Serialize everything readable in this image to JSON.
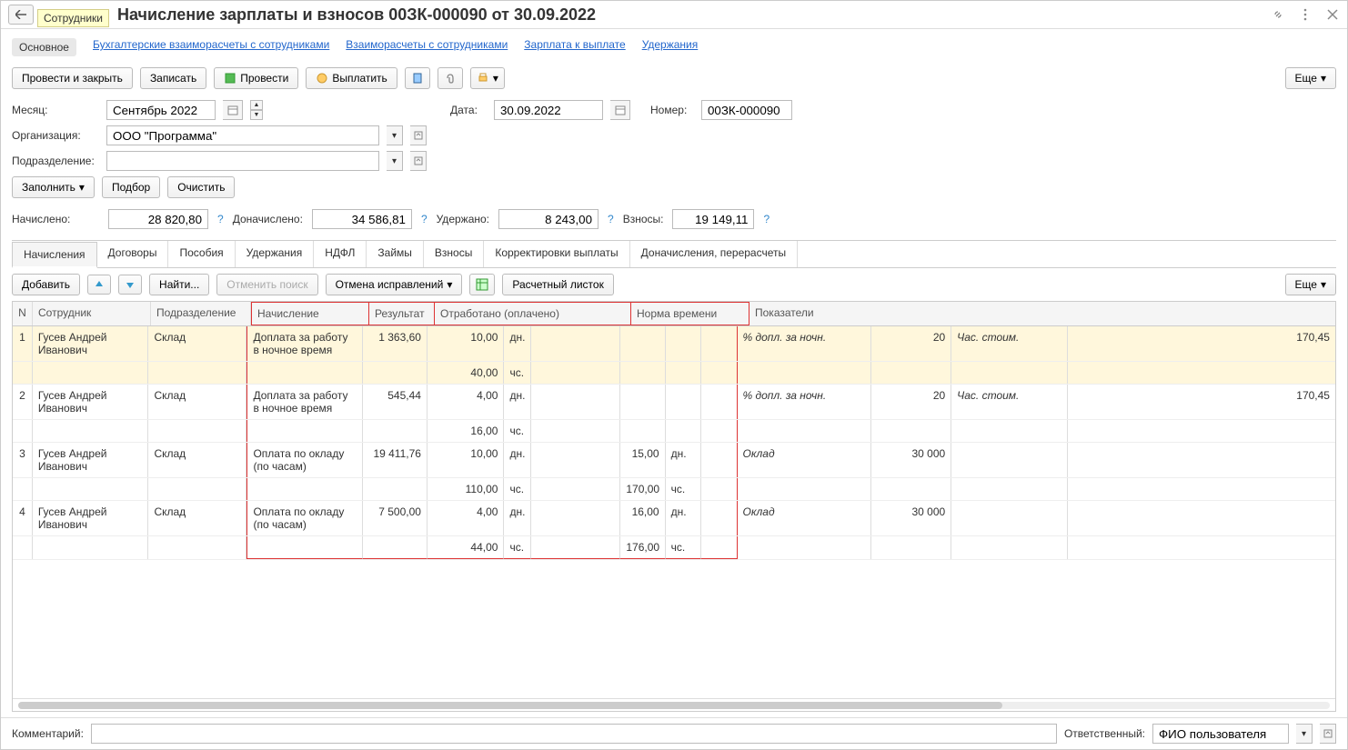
{
  "titlebar": {
    "back_tooltip": "Сотрудники",
    "title": "Начисление зарплаты и взносов 00ЗК-000090 от 30.09.2022"
  },
  "navtabs": {
    "main": "Основное",
    "mutual_emp": "Бухгалтерские взаиморасчеты с сотрудниками",
    "mutual": "Взаиморасчеты с сотрудниками",
    "pay": "Зарплата к выплате",
    "deduct": "Удержания"
  },
  "toolbar": {
    "post_close": "Провести и закрыть",
    "save": "Записать",
    "post": "Провести",
    "pay": "Выплатить",
    "more": "Еще"
  },
  "form": {
    "month_label": "Месяц:",
    "month_value": "Сентябрь 2022",
    "date_label": "Дата:",
    "date_value": "30.09.2022",
    "number_label": "Номер:",
    "number_value": "00ЗК-000090",
    "org_label": "Организация:",
    "org_value": "ООО \"Программа\"",
    "dept_label": "Подразделение:",
    "dept_value": ""
  },
  "fill_bar": {
    "fill": "Заполнить",
    "pick": "Подбор",
    "clear": "Очистить"
  },
  "totals": {
    "accrued_label": "Начислено:",
    "accrued_value": "28 820,80",
    "add_accrued_label": "Доначислено:",
    "add_accrued_value": "34 586,81",
    "withheld_label": "Удержано:",
    "withheld_value": "8 243,00",
    "contrib_label": "Взносы:",
    "contrib_value": "19 149,11"
  },
  "subtabs": {
    "accruals": "Начисления",
    "contracts": "Договоры",
    "benefits": "Пособия",
    "deductions": "Удержания",
    "ndfl": "НДФЛ",
    "loans": "Займы",
    "contribs": "Взносы",
    "corrections": "Корректировки выплаты",
    "add_accruals": "Доначисления, перерасчеты"
  },
  "table_toolbar": {
    "add": "Добавить",
    "find": "Найти...",
    "cancel_find": "Отменить поиск",
    "cancel_fix": "Отмена исправлений",
    "payslip": "Расчетный листок",
    "more": "Еще"
  },
  "columns": {
    "n": "N",
    "emp": "Сотрудник",
    "dep": "Подразделение",
    "accr": "Начисление",
    "res": "Результат",
    "work": "Отработано (оплачено)",
    "norm": "Норма времени",
    "ind": "Показатели"
  },
  "rows": [
    {
      "n": "1",
      "emp": "Гусев Андрей Иванович",
      "dep": "Склад",
      "accr": "Доплата за работу в ночное время",
      "res": "1 363,60",
      "work": "10,00",
      "work_u": "дн.",
      "work2": "40,00",
      "work2_u": "чс.",
      "norm": "",
      "norm_u": "",
      "norm2": "",
      "norm2_u": "",
      "ind": "% допл. за ночн.",
      "ind_v": "20",
      "ind2": "Час. стоим.",
      "ind2_v": "170,45"
    },
    {
      "n": "2",
      "emp": "Гусев Андрей Иванович",
      "dep": "Склад",
      "accr": "Доплата за работу в ночное время",
      "res": "545,44",
      "work": "4,00",
      "work_u": "дн.",
      "work2": "16,00",
      "work2_u": "чс.",
      "norm": "",
      "norm_u": "",
      "norm2": "",
      "norm2_u": "",
      "ind": "% допл. за ночн.",
      "ind_v": "20",
      "ind2": "Час. стоим.",
      "ind2_v": "170,45"
    },
    {
      "n": "3",
      "emp": "Гусев Андрей Иванович",
      "dep": "Склад",
      "accr": "Оплата по окладу (по часам)",
      "res": "19 411,76",
      "work": "10,00",
      "work_u": "дн.",
      "work2": "110,00",
      "work2_u": "чс.",
      "norm": "15,00",
      "norm_u": "дн.",
      "norm2": "170,00",
      "norm2_u": "чс.",
      "ind": "Оклад",
      "ind_v": "30 000",
      "ind2": "",
      "ind2_v": ""
    },
    {
      "n": "4",
      "emp": "Гусев Андрей Иванович",
      "dep": "Склад",
      "accr": "Оплата по окладу (по часам)",
      "res": "7 500,00",
      "work": "4,00",
      "work_u": "дн.",
      "work2": "44,00",
      "work2_u": "чс.",
      "norm": "16,00",
      "norm_u": "дн.",
      "norm2": "176,00",
      "norm2_u": "чс.",
      "ind": "Оклад",
      "ind_v": "30 000",
      "ind2": "",
      "ind2_v": ""
    }
  ],
  "footer": {
    "comment_label": "Комментарий:",
    "comment_value": "",
    "responsible_label": "Ответственный:",
    "responsible_value": "ФИО пользователя"
  }
}
